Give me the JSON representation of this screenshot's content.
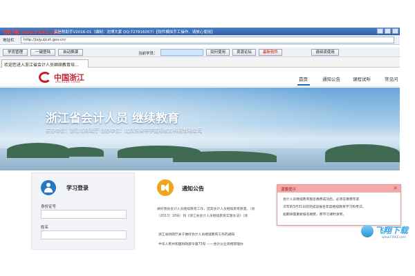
{
  "app": {
    "logo_text": "飞翔下载 www.FXXZ.com",
    "window_title": "买信税助手V2016-01（编制：沈博大家 QQ:727816057）【软件模拟手工操作，请放心使用】"
  },
  "address_bar": {
    "label": "地址栏",
    "url": "http://jxjy.zjczt.gov.cn/"
  },
  "toolbar": {
    "buttons": [
      "学员管理",
      "一键登陆",
      "自动换课",
      "如何使用",
      "资源论坛",
      "最新软件",
      "请阅读使用"
    ],
    "current_student_label": "当前学员：",
    "current_student_value": ""
  },
  "browser_tab": {
    "label": "欢迎您进入浙江省会计人员继续教育培..."
  },
  "site": {
    "brand_name": "中国浙江",
    "brand_en": "ZHEJIANG CHINA",
    "nav": [
      "首页",
      "通知公告",
      "课程试听",
      "常见问"
    ]
  },
  "banner": {
    "title": "浙江省会计人员 继续教育",
    "subtitle": "主办单位：浙江省财政厅    协办单位：北京东奥华宇国际教育科技有限公司"
  },
  "login": {
    "title": "学习登录",
    "id_label": "身份证号",
    "name_label": "姓名"
  },
  "notice": {
    "title": "通知公告",
    "paragraph": [
      "做好我省会计人员继续教育工作，提高会计人员继续教育质量，（浙",
      "〔2013〕18号）和《浙江省会计人员继续教育实施办法》（浙"
    ],
    "items": [
      "浙江省财政厅关于做好会计人员继续教育工作的通知",
      "中华人民共和国财政部令第73号 ——会计从业资格管理办"
    ]
  },
  "popup": {
    "title": "温馨提示",
    "lines": [
      "会计人员继续教育报名缴费成功后，必须在缴费年度",
      "次年的3月31日前完成该报名年度继续教育学习和考试，",
      "逾期将需重新报名缴费，原学习课时清零。"
    ]
  },
  "watermark": {
    "text": "飞翔下载",
    "url": "www.FXXZ.com"
  }
}
